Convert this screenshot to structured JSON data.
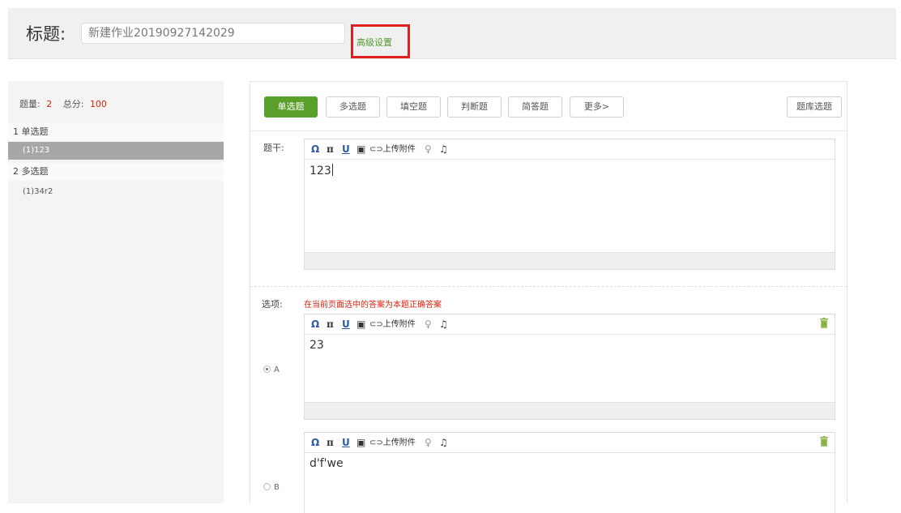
{
  "header": {
    "title_label": "标题:",
    "title_value": "新建作业20190927142029",
    "advanced_settings": "高级设置"
  },
  "sidebar": {
    "count_label": "题量:",
    "count_value": "2",
    "score_label": "总分:",
    "score_value": "100",
    "sections": [
      {
        "label": "1 单选题",
        "items": [
          "(1)123"
        ]
      },
      {
        "label": "2 多选题",
        "items": [
          "(1)34r2"
        ]
      }
    ]
  },
  "tabs": {
    "single": "单选题",
    "multi": "多选题",
    "fill": "填空题",
    "judge": "判断题",
    "short": "简答题",
    "more": "更多>",
    "bank": "题库选题"
  },
  "stem": {
    "label": "题干:",
    "content": "123"
  },
  "toolbar": {
    "omega": "Ω",
    "pi": "π",
    "underline": "U",
    "image": "▣",
    "upload": "⊂⊃上传附件",
    "mic": "♀",
    "music": "♫"
  },
  "options": {
    "label": "选项:",
    "hint": "在当前页面选中的答案为本题正确答案",
    "items": [
      {
        "letter": "A",
        "content": "23",
        "checked": true
      },
      {
        "letter": "B",
        "content": "d'f'we",
        "checked": false
      }
    ]
  },
  "colors": {
    "accent_green": "#5a9f2a",
    "highlight_red": "#e01f1f",
    "number_red": "#d9230f"
  }
}
